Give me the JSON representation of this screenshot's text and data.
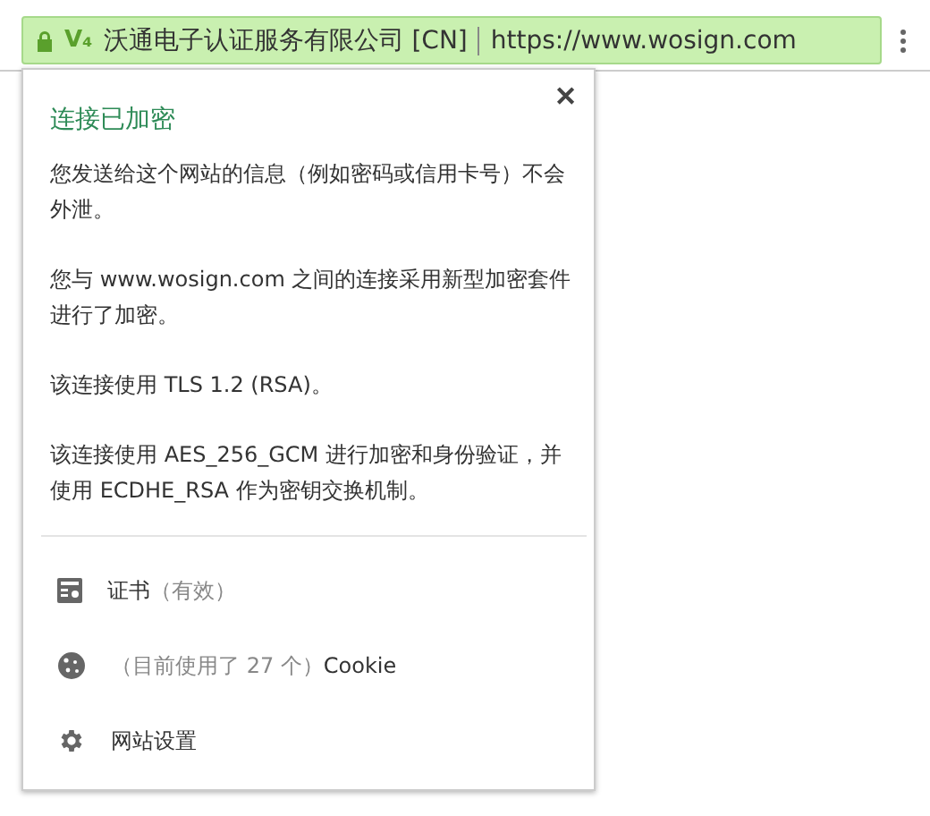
{
  "address_bar": {
    "secure": true,
    "ev_badge": "V₄",
    "owner": "沃通电子认证服务有限公司 [CN]",
    "url": "https://www.wosign.com"
  },
  "popup": {
    "close": "✕",
    "title": "连接已加密",
    "paragraphs": [
      "您发送给这个网站的信息（例如密码或信用卡号）不会外泄。",
      "您与 www.wosign.com 之间的连接采用新型加密套件进行了加密。",
      "该连接使用 TLS 1.2 (RSA)。",
      "该连接使用 AES_256_GCM 进行加密和身份验证，并使用 ECDHE_RSA 作为密钥交换机制。"
    ],
    "items": [
      {
        "kind": "certificate",
        "label": "证书",
        "note": "（有效）"
      },
      {
        "kind": "cookies",
        "note": "（目前使用了 27 个）",
        "label": "Cookie"
      },
      {
        "kind": "settings",
        "label": "网站设置"
      }
    ]
  }
}
